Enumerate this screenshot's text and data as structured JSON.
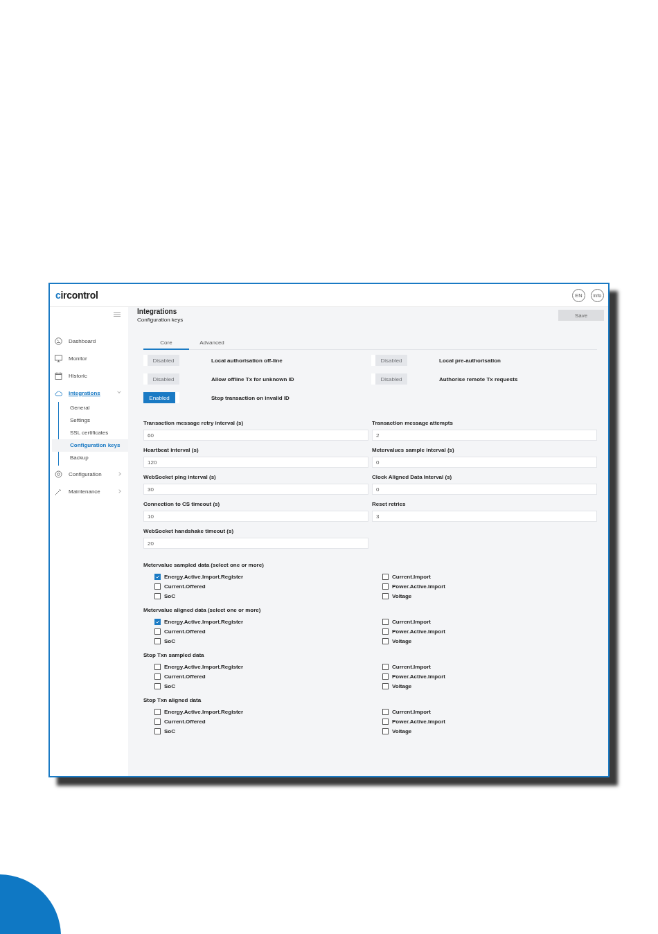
{
  "header": {
    "logo": "circontrol",
    "language": "EN",
    "info": "info"
  },
  "sidebar": {
    "items": [
      {
        "label": "Dashboard",
        "selected": false
      },
      {
        "label": "Monitor",
        "selected": false
      },
      {
        "label": "Historic",
        "selected": false
      },
      {
        "label": "Integrations",
        "selected": true,
        "expanded": true,
        "children": [
          {
            "label": "General",
            "selected": false
          },
          {
            "label": "Settings",
            "selected": false
          },
          {
            "label": "SSL certificates",
            "selected": false
          },
          {
            "label": "Configuration keys",
            "selected": true
          },
          {
            "label": "Backup",
            "selected": false
          }
        ]
      },
      {
        "label": "Configuration",
        "selected": false,
        "expanded": false
      },
      {
        "label": "Maintenance",
        "selected": false,
        "expanded": false
      }
    ]
  },
  "page": {
    "title": "Integrations",
    "subtitle": "Configuration keys",
    "save_button": {
      "label": "Save",
      "disabled": true
    }
  },
  "tabs": [
    {
      "label": "Core",
      "selected": true
    },
    {
      "label": "Advanced",
      "selected": false
    }
  ],
  "toggles": [
    {
      "label": "Local authorisation off-line",
      "state_text": "Disabled",
      "on": false
    },
    {
      "label": "Local pre-authorisation",
      "state_text": "Disabled",
      "on": false
    },
    {
      "label": "Allow offline Tx for unknown ID",
      "state_text": "Disabled",
      "on": false
    },
    {
      "label": "Authorise remote Tx requests",
      "state_text": "Disabled",
      "on": false
    },
    {
      "label": "Stop transaction on invalid ID",
      "state_text": "Enabled",
      "on": true
    }
  ],
  "fields": [
    {
      "label": "Transaction message retry interval (s)",
      "value": "60"
    },
    {
      "label": "Transaction message attempts",
      "value": "2"
    },
    {
      "label": "Heartbeat interval (s)",
      "value": "120"
    },
    {
      "label": "Metervalues sample interval (s)",
      "value": "0"
    },
    {
      "label": "WebSocket ping interval (s)",
      "value": "30"
    },
    {
      "label": "Clock Aligned Data Interval (s)",
      "value": "0"
    },
    {
      "label": "Connection to CS timeout (s)",
      "value": "10"
    },
    {
      "label": "Reset retries",
      "value": "3"
    },
    {
      "label": "WebSocket handshake timeout (s)",
      "value": "20"
    }
  ],
  "checkbox_groups": [
    {
      "title": "Metervalue sampled data (select one or more)",
      "options": [
        {
          "label": "Energy.Active.Import.Register",
          "checked": true
        },
        {
          "label": "Current.Import",
          "checked": false
        },
        {
          "label": "Current.Offered",
          "checked": false
        },
        {
          "label": "Power.Active.Import",
          "checked": false
        },
        {
          "label": "SoC",
          "checked": false
        },
        {
          "label": "Voltage",
          "checked": false
        }
      ]
    },
    {
      "title": "Metervalue aligned data (select one or more)",
      "options": [
        {
          "label": "Energy.Active.Import.Register",
          "checked": true
        },
        {
          "label": "Current.Import",
          "checked": false
        },
        {
          "label": "Current.Offered",
          "checked": false
        },
        {
          "label": "Power.Active.Import",
          "checked": false
        },
        {
          "label": "SoC",
          "checked": false
        },
        {
          "label": "Voltage",
          "checked": false
        }
      ]
    },
    {
      "title": "Stop Txn sampled data",
      "options": [
        {
          "label": "Energy.Active.Import.Register",
          "checked": false
        },
        {
          "label": "Current.Import",
          "checked": false
        },
        {
          "label": "Current.Offered",
          "checked": false
        },
        {
          "label": "Power.Active.Import",
          "checked": false
        },
        {
          "label": "SoC",
          "checked": false
        },
        {
          "label": "Voltage",
          "checked": false
        }
      ]
    },
    {
      "title": "Stop Txn aligned data",
      "options": [
        {
          "label": "Energy.Active.Import.Register",
          "checked": false
        },
        {
          "label": "Current.Import",
          "checked": false
        },
        {
          "label": "Current.Offered",
          "checked": false
        },
        {
          "label": "Power.Active.Import",
          "checked": false
        },
        {
          "label": "SoC",
          "checked": false
        },
        {
          "label": "Voltage",
          "checked": false
        }
      ]
    }
  ]
}
